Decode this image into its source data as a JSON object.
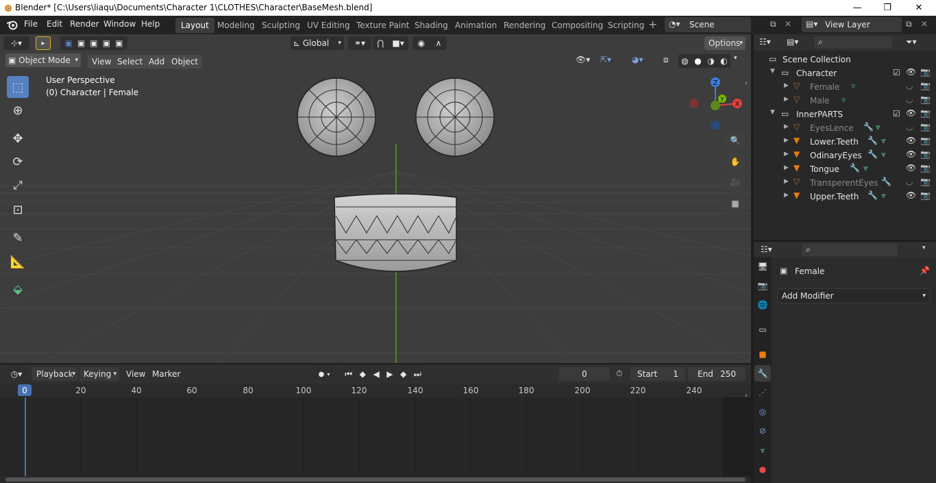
{
  "window": {
    "title": "Blender* [C:\\Users\\liaqu\\Documents\\Character 1\\CLOTHES\\Character\\BaseMesh.blend]",
    "minimize": "—",
    "maximize": "❐",
    "close": "✕"
  },
  "menu": {
    "file": "File",
    "edit": "Edit",
    "render": "Render",
    "window": "Window",
    "help": "Help"
  },
  "workspaces": [
    "Layout",
    "Modeling",
    "Sculpting",
    "UV Editing",
    "Texture Paint",
    "Shading",
    "Animation",
    "Rendering",
    "Compositing",
    "Scripting"
  ],
  "scene": {
    "name": "Scene",
    "view_layer": "View Layer"
  },
  "viewport": {
    "transform_orientation": "Global",
    "options": "Options",
    "mode": "Object Mode",
    "menus": [
      "View",
      "Select",
      "Add",
      "Object"
    ],
    "perspective": "User Perspective",
    "context": "(0) Character | Female",
    "gizmo": {
      "x": "X",
      "y": "Y",
      "z": "Z"
    }
  },
  "timeline": {
    "menus": [
      "Playback",
      "Keying",
      "View",
      "Marker"
    ],
    "current_frame": "0",
    "start_label": "Start",
    "start": "1",
    "end_label": "End",
    "end": "250",
    "ruler": [
      "0",
      "20",
      "40",
      "60",
      "80",
      "100",
      "120",
      "140",
      "160",
      "180",
      "200",
      "220",
      "240"
    ]
  },
  "outliner": {
    "root": "Scene Collection",
    "collections": [
      {
        "name": "Character",
        "children": [
          {
            "name": "Female",
            "dim": true
          },
          {
            "name": "Male",
            "dim": true
          }
        ]
      },
      {
        "name": "InnerPARTS",
        "children": [
          {
            "name": "EyesLence",
            "dim": true
          },
          {
            "name": "Lower.Teeth",
            "dim": false
          },
          {
            "name": "OdinaryEyes",
            "dim": false
          },
          {
            "name": "Tongue",
            "dim": false
          },
          {
            "name": "TransperentEyes",
            "dim": true
          },
          {
            "name": "Upper.Teeth",
            "dim": false
          }
        ]
      }
    ]
  },
  "properties": {
    "object_name": "Female",
    "add_modifier": "Add Modifier"
  },
  "colors": {
    "accent": "#5680c2",
    "mesh_orange": "#e87d0d",
    "x_axis": "#e53e3e",
    "y_axis": "#78b800",
    "z_axis": "#3b7ee0",
    "wrench": "#7ea0e6",
    "data_green": "#5bc27e"
  }
}
